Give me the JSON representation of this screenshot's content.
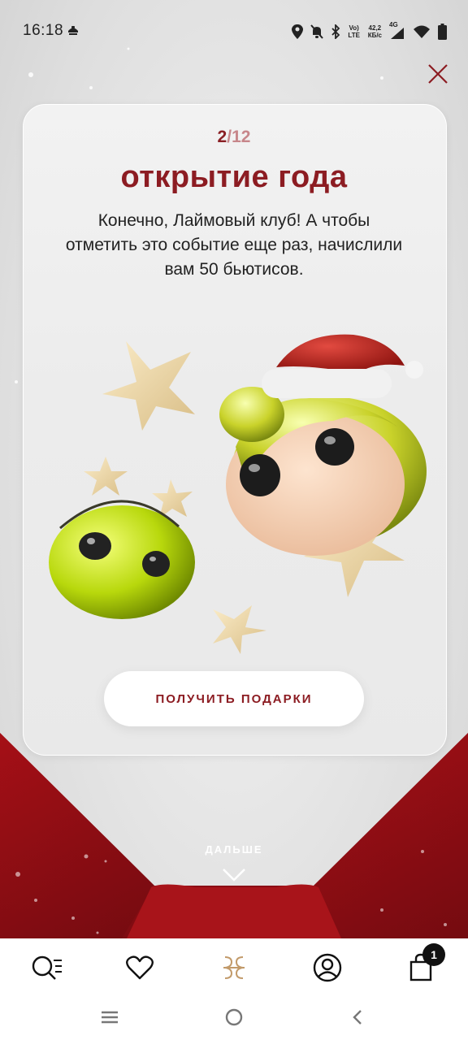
{
  "status_bar": {
    "time": "16:18",
    "network_speed": "42,2",
    "network_speed_unit": "КБ/с",
    "signal_tech_1": "Vo) LTE",
    "signal_tech_2": "4G"
  },
  "modal": {
    "counter_current": "2",
    "counter_separator": "/",
    "counter_total": "12",
    "title": "открытие года",
    "description": "Конечно, Лаймовый клуб! А чтобы отметить это событие еще раз, начислили вам 50 бьютисов.",
    "cta_label": "ПОЛУЧИТЬ ПОДАРКИ",
    "next_label": "ДАЛЬШЕ"
  },
  "tab_bar": {
    "cart_badge": "1",
    "tabs": [
      "search-catalog",
      "favorites",
      "club",
      "profile",
      "cart"
    ]
  },
  "colors": {
    "brand_red": "#8c1c22",
    "accent_red": "#a8141a",
    "background": "#e4e4e4"
  }
}
